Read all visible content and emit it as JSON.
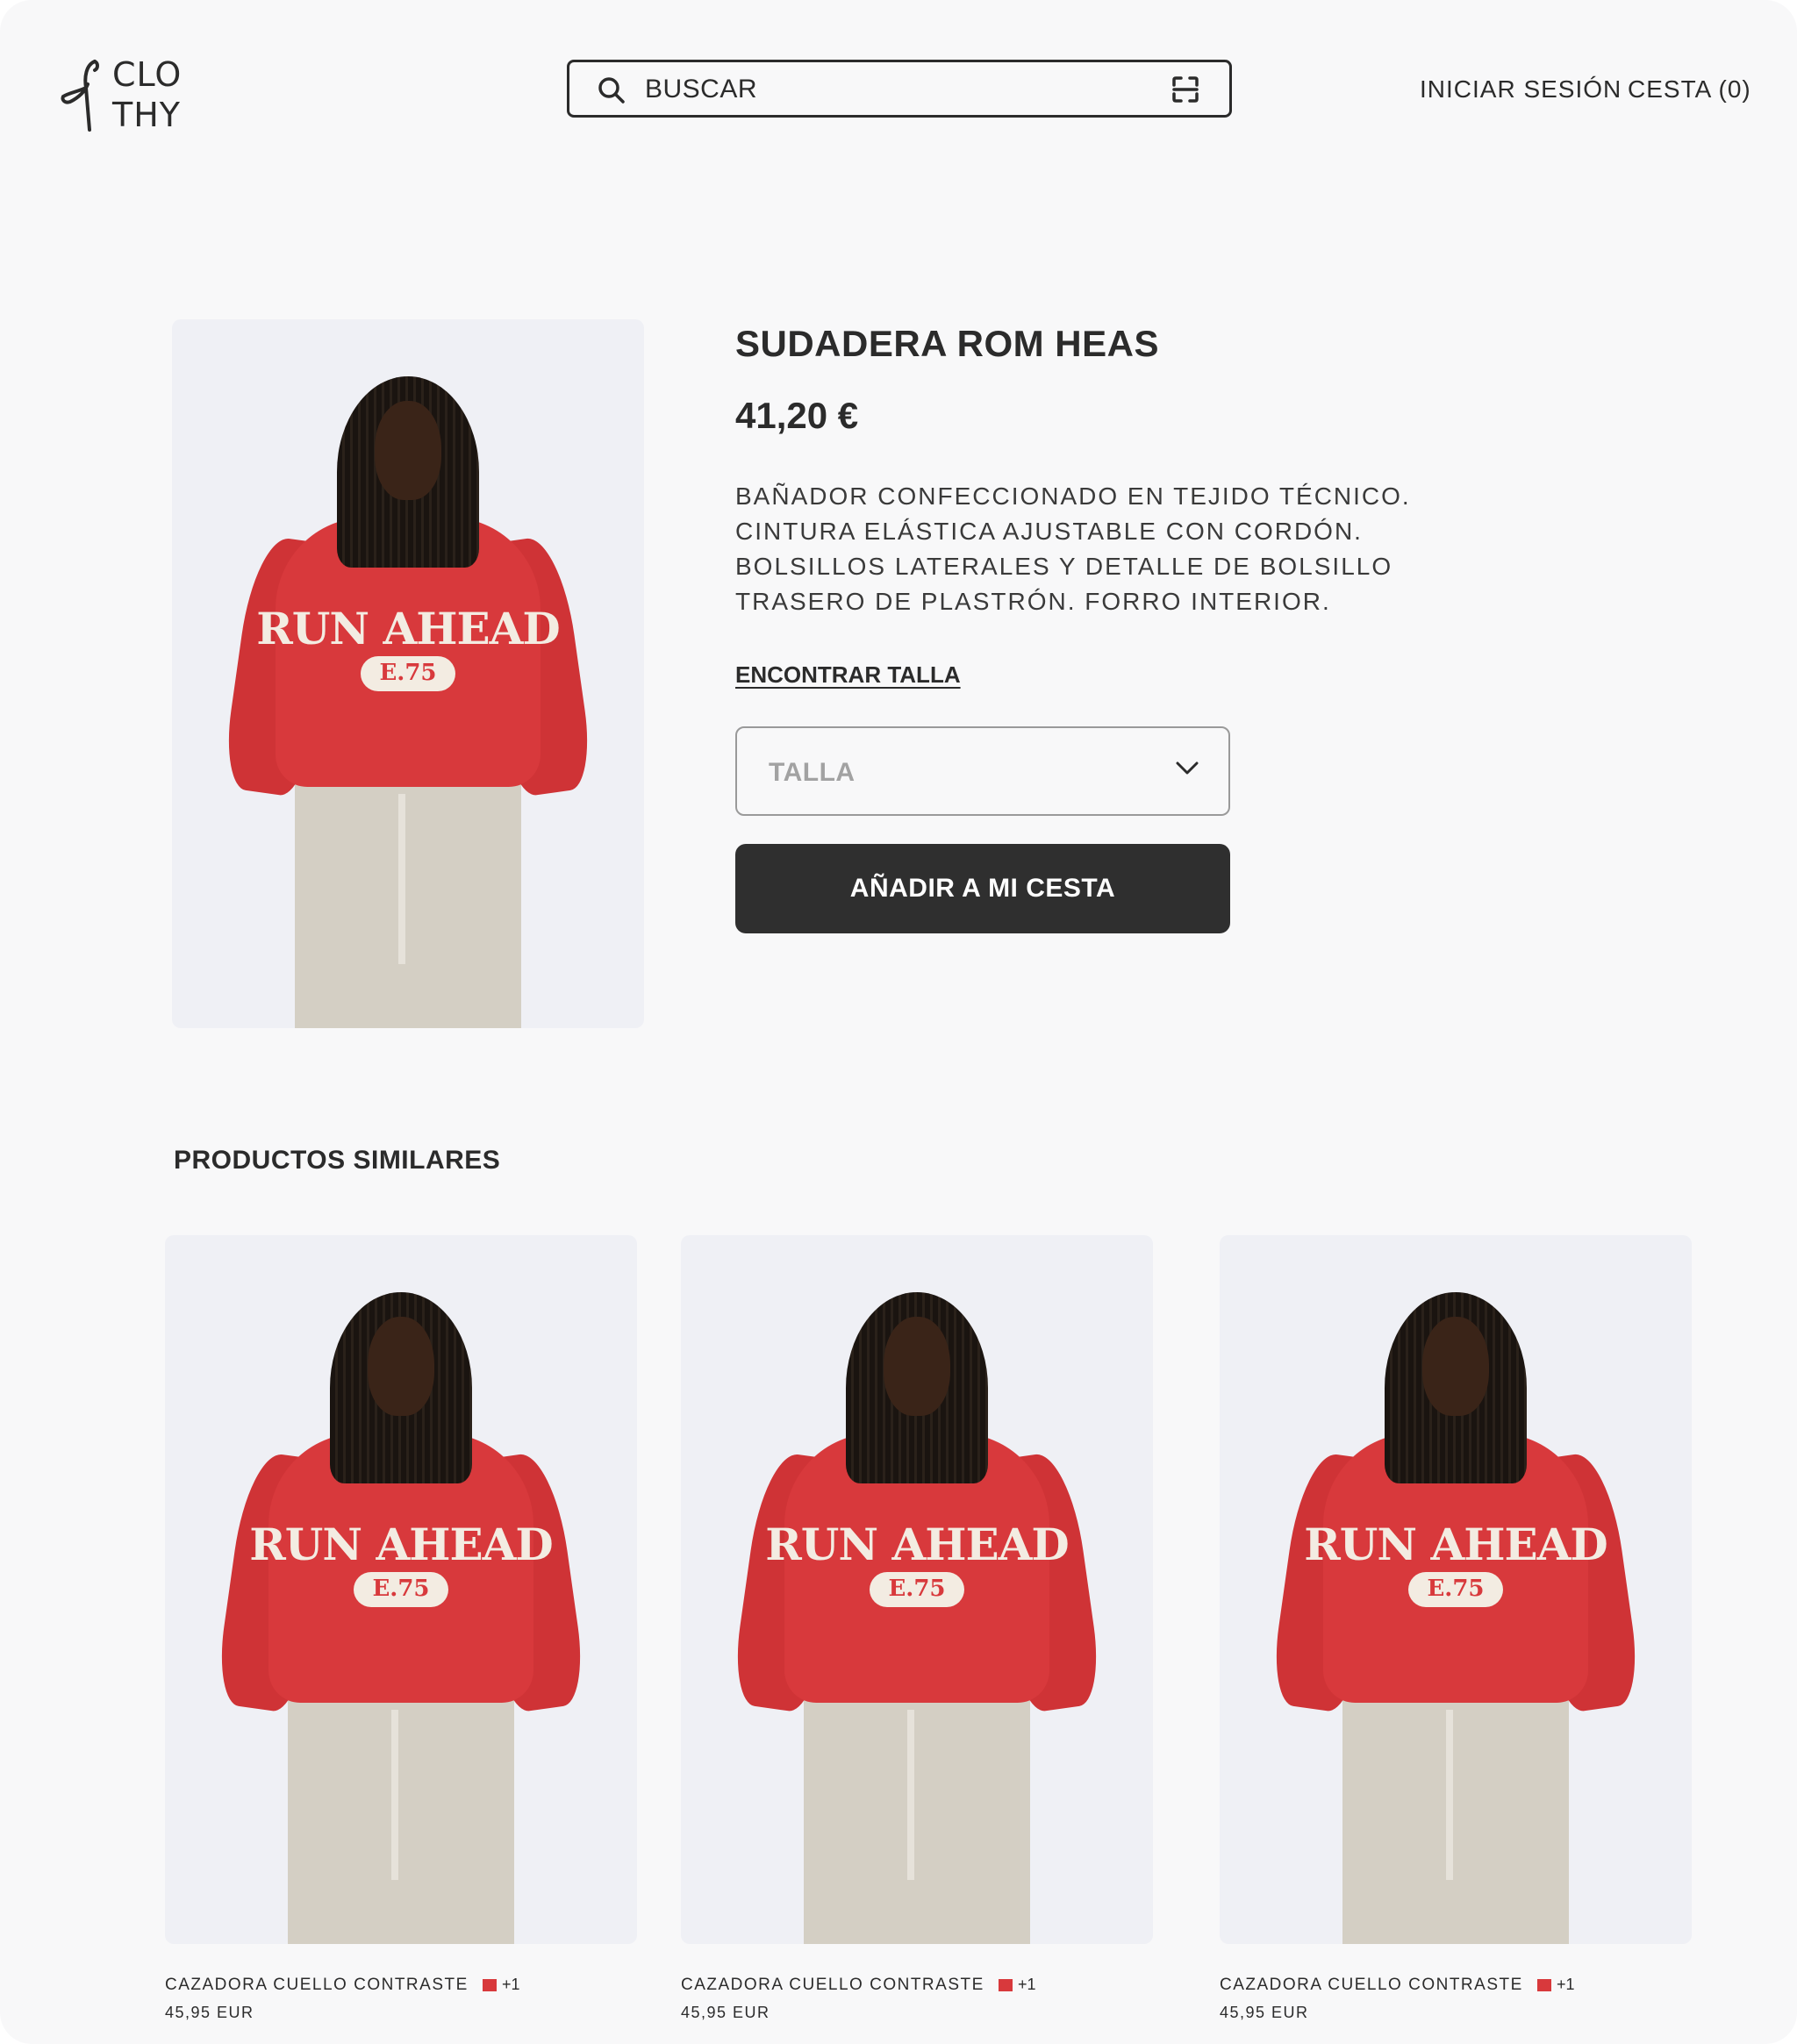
{
  "brand": {
    "line1": "CLO",
    "line2": "THY"
  },
  "search": {
    "placeholder": "BUSCAR"
  },
  "nav": {
    "login": "INICIAR SESIÓN",
    "cart": "CESTA (0)"
  },
  "product": {
    "title": "SUDADERA ROM HEAS",
    "price": "41,20 €",
    "description": [
      "BAÑADOR CONFECCIONADO EN TEJIDO TÉCNICO.",
      "CINTURA ELÁSTICA AJUSTABLE CON CORDÓN.",
      "BOLSILLOS LATERALES Y DETALLE DE BOLSILLO",
      "TRASERO DE PLASTRÓN. FORRO INTERIOR."
    ],
    "find_size": "ENCONTRAR TALLA",
    "size_placeholder": "TALLA",
    "add_to_cart": "AÑADIR A MI CESTA",
    "image_print": "RUN AHEAD",
    "image_badge": "E.75"
  },
  "similar": {
    "title": "PRODUCTOS SIMILARES",
    "items": [
      {
        "name": "CAZADORA CUELLO CONTRASTE",
        "colors_more": "+1",
        "price": "45,95 EUR",
        "swatch": "#d8393c"
      },
      {
        "name": "CAZADORA CUELLO CONTRASTE",
        "colors_more": "+1",
        "price": "45,95 EUR",
        "swatch": "#d8393c"
      },
      {
        "name": "CAZADORA CUELLO CONTRASTE",
        "colors_more": "+1",
        "price": "45,95 EUR",
        "swatch": "#d8393c"
      }
    ]
  },
  "colors": {
    "accent_dark": "#2f2f2f",
    "sweater_red": "#d8393c",
    "background": "#f8f8f9"
  },
  "icons": [
    "hanger-logo-icon",
    "search-icon",
    "scan-icon",
    "chevron-down-icon"
  ]
}
